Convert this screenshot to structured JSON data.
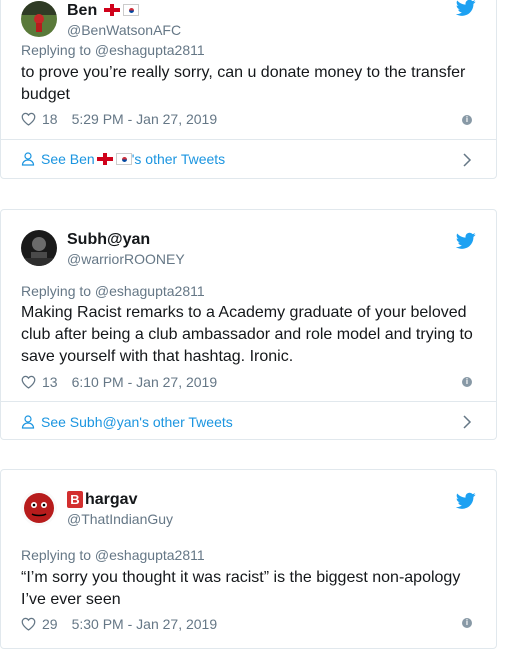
{
  "tweets": [
    {
      "display_name": "Ben",
      "handle": "@BenWatsonAFC",
      "replying_to": "Replying to @eshagupta2811",
      "text": "to prove you’re really sorry, can u donate money to the transfer budget",
      "likes": "18",
      "timestamp": "5:29 PM - Jan 27, 2019",
      "see_other_prefix": "See Ben",
      "see_other_suffix": "'s other Tweets"
    },
    {
      "display_name": "Subh@yan",
      "handle": "@warriorROONEY",
      "replying_to": "Replying to @eshagupta2811",
      "text": "Making Racist remarks to a Academy graduate of your beloved club after being a club ambassador and role model and trying to save yourself with that hashtag. Ironic.",
      "likes": "13",
      "timestamp": "6:10 PM - Jan 27, 2019",
      "see_other": "See Subh@yan's other Tweets"
    },
    {
      "display_name_badge": "B",
      "display_name": "hargav",
      "handle": "@ThatIndianGuy",
      "replying_to": "Replying to @eshagupta2811",
      "text": "“I’m sorry you thought it was racist” is the biggest non-apology I’ve ever seen",
      "likes": "29",
      "timestamp": "5:30 PM - Jan 27, 2019"
    }
  ],
  "icons": {
    "bird": "twitter-bird-icon",
    "heart": "heart-icon",
    "info": "info-icon",
    "person": "person-icon",
    "chevron": "chevron-right-icon"
  },
  "colors": {
    "twitter_blue": "#1da1f2",
    "link_blue": "#1b95e0",
    "secondary_text": "#657786",
    "border": "#e1e8ed"
  }
}
